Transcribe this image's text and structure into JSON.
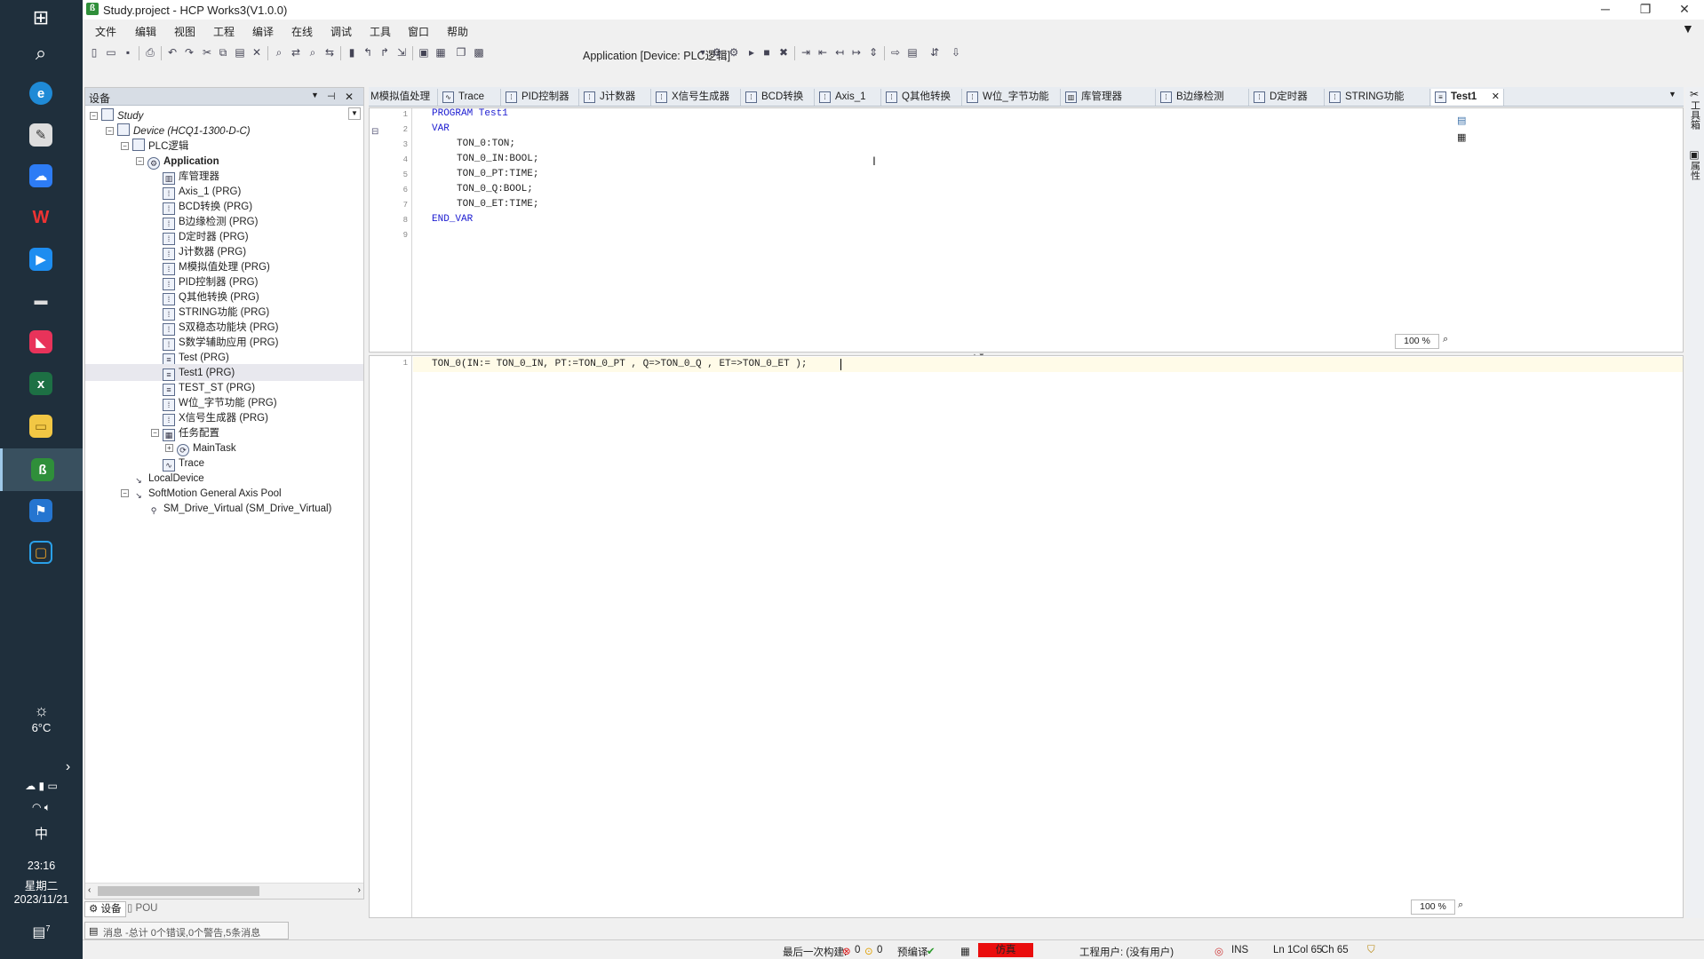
{
  "taskbar": {
    "weather_temp": "6°C",
    "ime": "中",
    "time": "23:16",
    "weekday": "星期二",
    "date": "2023/11/21",
    "notification_count": "7"
  },
  "window": {
    "title": "Study.project - HCP Works3(V1.0.0)",
    "menu": [
      "文件",
      "编辑",
      "视图",
      "工程",
      "编译",
      "在线",
      "调试",
      "工具",
      "窗口",
      "帮助"
    ],
    "app_selector": "Application [Device: PLC逻辑]"
  },
  "device_panel": {
    "title": "设备",
    "tree": [
      {
        "label": "Study",
        "italic": true
      },
      {
        "label": "Device (HCQ1-1300-D-C)",
        "italic": true
      },
      {
        "label": "PLC逻辑"
      },
      {
        "label": "Application",
        "bold": true
      },
      {
        "label": "库管理器"
      },
      {
        "label": "Axis_1 (PRG)"
      },
      {
        "label": "BCD转换 (PRG)"
      },
      {
        "label": "B边缘检测 (PRG)"
      },
      {
        "label": "D定时器 (PRG)"
      },
      {
        "label": "J计数器 (PRG)"
      },
      {
        "label": "M模拟值处理 (PRG)"
      },
      {
        "label": "PID控制器 (PRG)"
      },
      {
        "label": "Q其他转换 (PRG)"
      },
      {
        "label": "STRING功能 (PRG)"
      },
      {
        "label": "S双稳态功能块 (PRG)"
      },
      {
        "label": "S数学辅助应用 (PRG)"
      },
      {
        "label": "Test (PRG)"
      },
      {
        "label": "Test1 (PRG)"
      },
      {
        "label": "TEST_ST (PRG)"
      },
      {
        "label": "W位_字节功能 (PRG)"
      },
      {
        "label": "X信号生成器 (PRG)"
      },
      {
        "label": "任务配置"
      },
      {
        "label": "MainTask"
      },
      {
        "label": "Trace"
      },
      {
        "label": "LocalDevice"
      },
      {
        "label": "SoftMotion General Axis Pool"
      },
      {
        "label": "SM_Drive_Virtual (SM_Drive_Virtual)"
      }
    ],
    "bottom_tabs": [
      "设备",
      "POU"
    ]
  },
  "messages": "消息 -总计 0个错误,0个警告,5条消息",
  "editor_tabs": [
    "M模拟值处理",
    "Trace",
    "PID控制器",
    "J计数器",
    "X信号生成器",
    "BCD转换",
    "Axis_1",
    "Q其他转换",
    "W位_字节功能",
    "库管理器",
    "B边缘检测",
    "D定时器",
    "STRING功能",
    "Test1"
  ],
  "declaration": {
    "line_numbers": [
      "1",
      "2",
      "3",
      "4",
      "5",
      "6",
      "7",
      "8",
      "9"
    ],
    "lines": [
      "PROGRAM Test1",
      "VAR",
      "TON_0:TON;",
      "TON_0_IN:BOOL;",
      "TON_0_PT:TIME;",
      "TON_0_Q:BOOL;",
      "TON_0_ET:TIME;",
      "END_VAR",
      ""
    ],
    "zoom": "100 %"
  },
  "implementation": {
    "line_numbers": [
      "1"
    ],
    "lines": [
      "TON_0(IN:= TON_0_IN, PT:=TON_0_PT , Q=>TON_0_Q , ET=>TON_0_ET );"
    ],
    "zoom": "100 %"
  },
  "right_panel": {
    "tab1": "工具箱",
    "tab2": "属性"
  },
  "status": {
    "last_build_label": "最后一次构建:",
    "errors": "0",
    "warnings": "0",
    "precompile": "预编译",
    "sim": "仿真",
    "project_user": "工程用户: (没有用户)",
    "ins": "INS",
    "ln": "Ln 1",
    "col": "Col 65",
    "ch": "Ch 65"
  }
}
